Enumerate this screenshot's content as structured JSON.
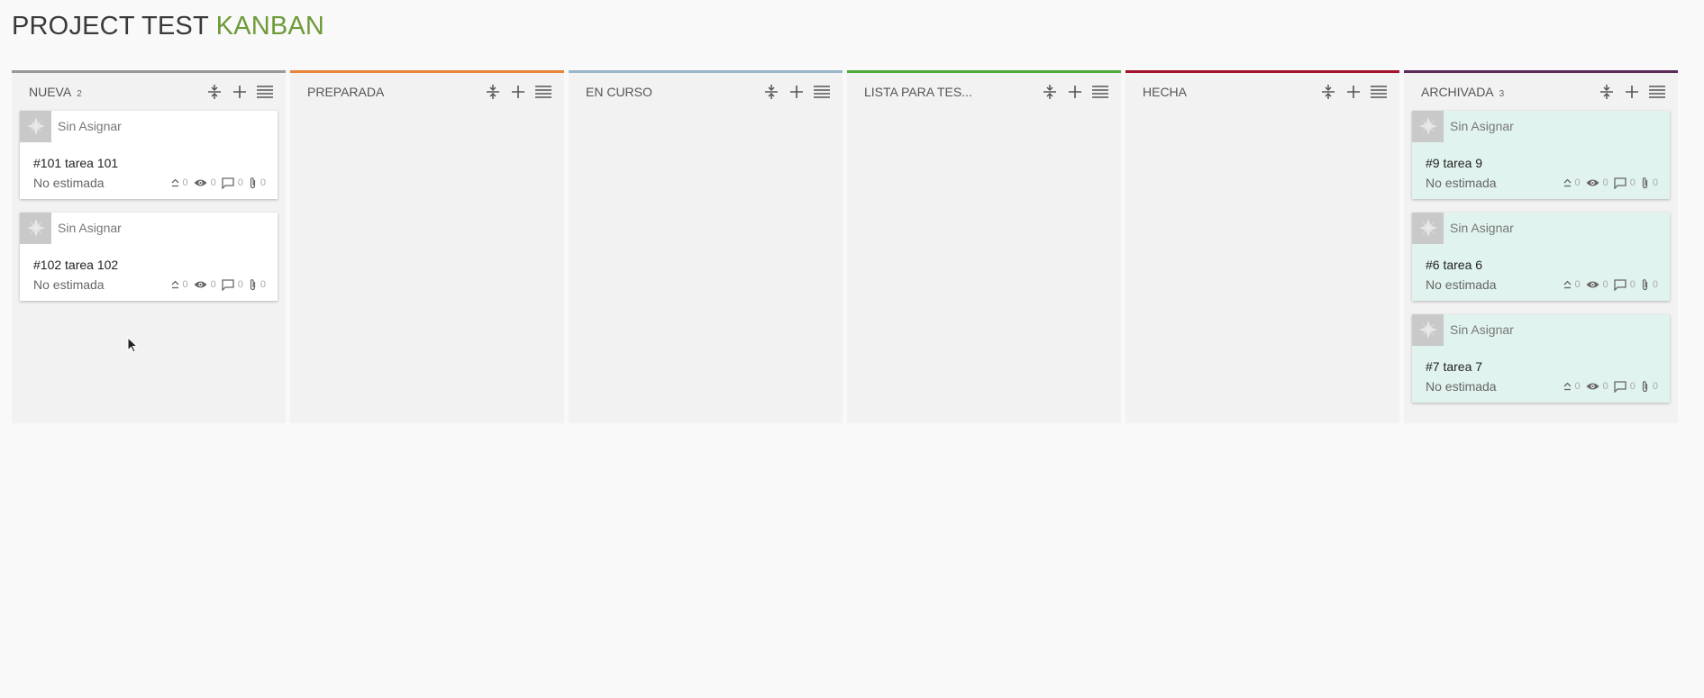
{
  "page": {
    "title_main": "PROJECT TEST",
    "title_accent": "KANBAN",
    "accent_color": "#6e9a3a"
  },
  "columns": [
    {
      "title": "NUEVA",
      "count": "2",
      "color": "#999999",
      "cards": [
        {
          "assignee": "Sin Asignar",
          "title": "#101 tarea 101",
          "estimate": "No estimada",
          "votes": "0",
          "watchers": "0",
          "comments": "0",
          "attachments": "0"
        },
        {
          "assignee": "Sin Asignar",
          "title": "#102 tarea 102",
          "estimate": "No estimada",
          "votes": "0",
          "watchers": "0",
          "comments": "0",
          "attachments": "0"
        }
      ]
    },
    {
      "title": "PREPARADA",
      "count": "",
      "color": "#e8853a",
      "cards": []
    },
    {
      "title": "EN CURSO",
      "count": "",
      "color": "#9ab6c8",
      "cards": []
    },
    {
      "title": "LISTA PARA TES...",
      "count": "",
      "color": "#4fa83a",
      "cards": []
    },
    {
      "title": "HECHA",
      "count": "",
      "color": "#a3132c",
      "cards": []
    },
    {
      "title": "ARCHIVADA",
      "count": "3",
      "color": "#5b2b57",
      "cards": [
        {
          "assignee": "Sin Asignar",
          "title": "#9 tarea 9",
          "estimate": "No estimada",
          "votes": "0",
          "watchers": "0",
          "comments": "0",
          "attachments": "0"
        },
        {
          "assignee": "Sin Asignar",
          "title": "#6 tarea 6",
          "estimate": "No estimada",
          "votes": "0",
          "watchers": "0",
          "comments": "0",
          "attachments": "0"
        },
        {
          "assignee": "Sin Asignar",
          "title": "#7 tarea 7",
          "estimate": "No estimada",
          "votes": "0",
          "watchers": "0",
          "comments": "0",
          "attachments": "0"
        }
      ]
    }
  ],
  "icons": {
    "fold": "fold-column-icon",
    "add": "add-card-icon",
    "menu": "column-menu-icon",
    "avatar": "default-avatar-icon",
    "votes": "upvote-icon",
    "watchers": "eye-icon",
    "comments": "comment-icon",
    "attachments": "paperclip-icon",
    "cursor": "mouse-pointer-icon"
  }
}
